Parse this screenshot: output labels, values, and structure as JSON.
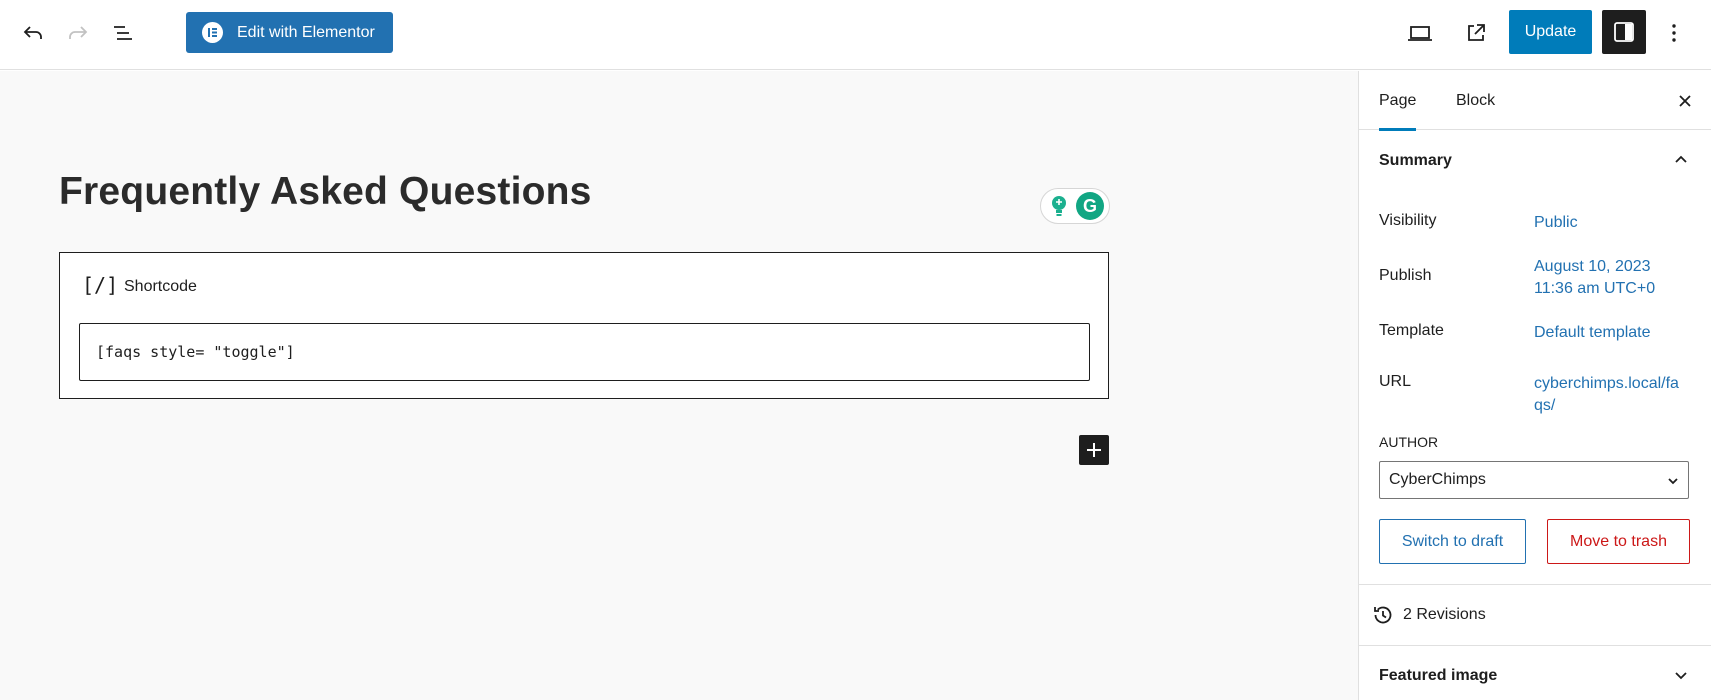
{
  "toolbar": {
    "undo_icon": "undo-icon",
    "redo_icon": "redo-icon",
    "list_view_icon": "list-view-icon",
    "elementor_label": "Edit with Elementor",
    "preview_icon": "desktop-preview-icon",
    "view_post_icon": "external-link-icon",
    "update_label": "Update",
    "settings_icon": "sidebar-toggle-icon",
    "more_icon": "more-vertical-icon"
  },
  "editor": {
    "title": "Frequently Asked Questions",
    "block": {
      "icon_text": "[/]",
      "label": "Shortcode",
      "value": "[faqs style= \"toggle\"]"
    }
  },
  "sidebar": {
    "tabs": [
      {
        "label": "Page",
        "active": true
      },
      {
        "label": "Block",
        "active": false
      }
    ],
    "summary": {
      "title": "Summary",
      "rows": [
        {
          "label": "Visibility",
          "value": "Public"
        },
        {
          "label": "Publish",
          "value": "August 10, 2023 11:36 am UTC+0"
        },
        {
          "label": "Template",
          "value": "Default template"
        },
        {
          "label": "URL",
          "value": "cyberchimps.local/faqs/"
        }
      ],
      "author_label": "AUTHOR",
      "author_value": "CyberChimps",
      "switch_draft": "Switch to draft",
      "move_trash": "Move to trash"
    },
    "revisions": "2 Revisions",
    "featured_image": "Featured image"
  },
  "colors": {
    "accent": "#007cba",
    "elementor": "#2271b1",
    "danger": "#cc1818",
    "dark": "#1e1e1e"
  }
}
